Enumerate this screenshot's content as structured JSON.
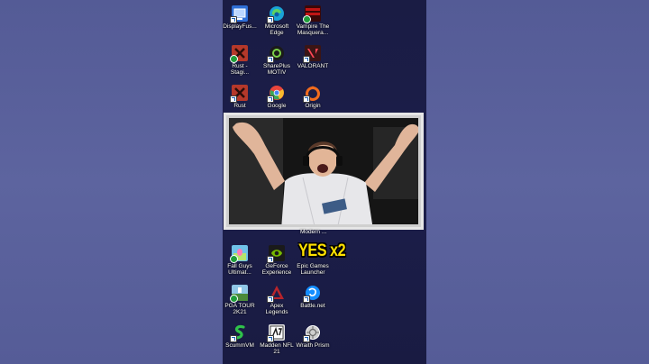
{
  "desktop_icons": [
    {
      "id": "displayfusion",
      "label": "DisplayFus...",
      "icon": "displayfusion-icon",
      "color": "#2f6fd6"
    },
    {
      "id": "edge",
      "label": "Microsoft\nEdge",
      "icon": "edge-icon",
      "color": "#1aa3d6"
    },
    {
      "id": "vampire",
      "label": "Vampire The\nMasquera...",
      "icon": "vampire-icon",
      "color": "#8a0d0d"
    },
    {
      "id": "rust-staging",
      "label": "Rust -\nStagi...",
      "icon": "rust-icon",
      "color": "#b5382a"
    },
    {
      "id": "shareplus",
      "label": "SharePlus\nMOTIV",
      "icon": "shareplus-icon",
      "color": "#2c2c2c"
    },
    {
      "id": "valorant",
      "label": "VALORANT",
      "icon": "valorant-icon",
      "color": "#e03a3a"
    },
    {
      "id": "rust",
      "label": "Rust",
      "icon": "rust-icon",
      "color": "#b5382a"
    },
    {
      "id": "google",
      "label": "Google",
      "icon": "chrome-icon",
      "color": "#e8453c"
    },
    {
      "id": "origin",
      "label": "Origin",
      "icon": "origin-icon",
      "color": "#f26c1d"
    },
    {
      "id": "fallguys",
      "label": "Fall Guys\nUltimat...",
      "icon": "fallguys-icon",
      "color": "#6fc2e8"
    },
    {
      "id": "geforce",
      "label": "GeForce\nExperience",
      "icon": "geforce-icon",
      "color": "#76b900"
    },
    {
      "id": "epic",
      "label": "Epic Games\nLauncher",
      "icon": "epic-icon",
      "color": "#2a2a2a"
    },
    {
      "id": "pgatour",
      "label": "PGA TOUR\n2K21",
      "icon": "pgatour-icon",
      "color": "#4b8a3a"
    },
    {
      "id": "apex",
      "label": "Apex\nLegends",
      "icon": "apex-icon",
      "color": "#b8242b"
    },
    {
      "id": "battlenet",
      "label": "Battle.net",
      "icon": "battlenet-icon",
      "color": "#148eff"
    },
    {
      "id": "scummvm",
      "label": "ScummVM",
      "icon": "scummvm-icon",
      "color": "#1f9d3a"
    },
    {
      "id": "madden",
      "label": "Madden NFL\n21",
      "icon": "madden-icon",
      "color": "#e6e6e6"
    },
    {
      "id": "wraith",
      "label": "Wraith Prism",
      "icon": "wraith-icon",
      "color": "#cfcfcf"
    }
  ],
  "webcam": {
    "label": "Modern ..."
  },
  "overlay": {
    "yes_text": "YES x2",
    "yes_color": "#ffe100"
  }
}
